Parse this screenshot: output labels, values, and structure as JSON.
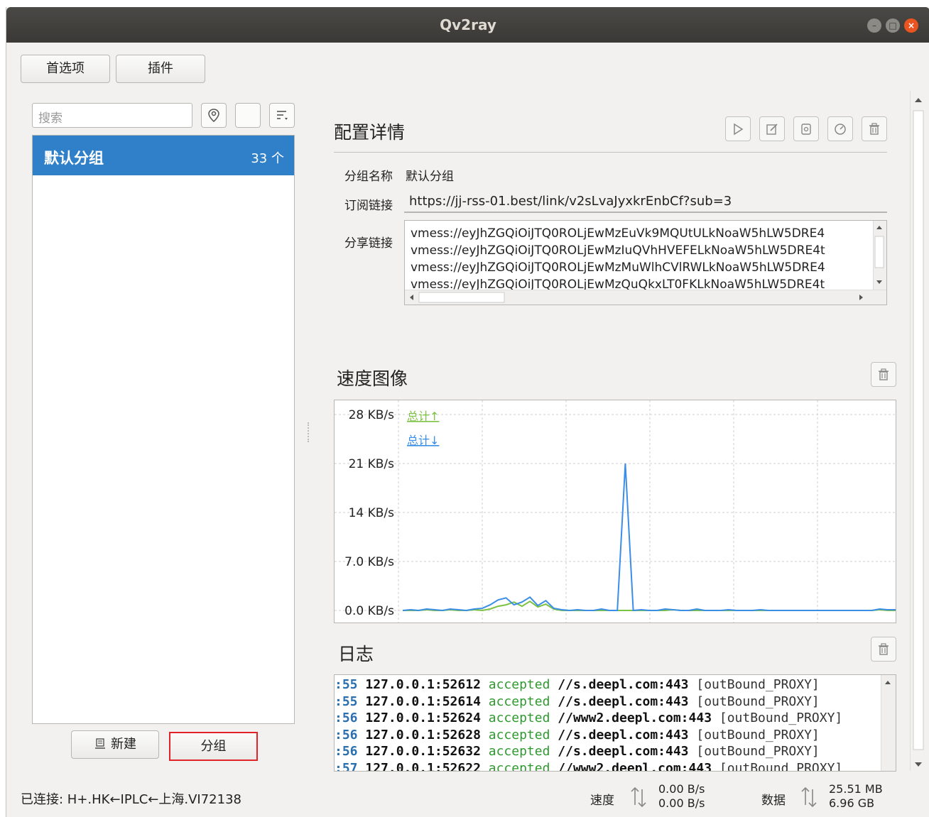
{
  "window": {
    "title": "Qv2ray"
  },
  "toolbar": {
    "preferences": "首选项",
    "plugins": "插件"
  },
  "search": {
    "placeholder": "搜索"
  },
  "group_list": [
    {
      "name": "默认分组",
      "count": "33 个"
    }
  ],
  "left_buttons": {
    "new": "新建",
    "group": "分组"
  },
  "details": {
    "title": "配置详情",
    "group_name_label": "分组名称",
    "group_name_value": "默认分组",
    "subscription_label": "订阅链接",
    "subscription_value": "https://jj-rss-01.best/link/v2sLvaJyxkrEnbCf?sub=3",
    "share_label": "分享链接",
    "share_lines": [
      "vmess://eyJhZGQiOiJTQ0ROLjEwMzEuVk9MQUtULkNoaW5hLW5DRE4",
      "vmess://eyJhZGQiOiJTQ0ROLjEwMzIuQVhHVEFELkNoaW5hLW5DRE4t",
      "vmess://eyJhZGQiOiJTQ0ROLjEwMzMuWlhCVlRWLkNoaW5hLW5DRE4",
      "vmess://eyJhZGQiOiJTQ0ROLjEwMzQuQkxLT0FKLkNoaW5hLW5DRE4t"
    ]
  },
  "speed_chart": {
    "title": "速度图像",
    "legend_up": "总计↑",
    "legend_down": "总计↓"
  },
  "chart_data": {
    "type": "line",
    "title": "速度图像",
    "yticks": [
      "28 KB/s",
      "21 KB/s",
      "14 KB/s",
      "7.0 KB/s",
      "0.0 KB/s"
    ],
    "ylim": [
      0,
      28
    ],
    "grid": true,
    "legend_placement": "top-left",
    "series": [
      {
        "name": "总计↑",
        "color": "#7cc243",
        "values": [
          0,
          0,
          0,
          0.1,
          0,
          0,
          0.1,
          0,
          0,
          0.1,
          0,
          0.2,
          0.6,
          0.8,
          1.2,
          0.6,
          1.3,
          0.5,
          0.9,
          0.2,
          0,
          0,
          0,
          0,
          0,
          0,
          0,
          0,
          0,
          0,
          0,
          0,
          0,
          0,
          0.1,
          0,
          0,
          0,
          0,
          0,
          0,
          0,
          0,
          0,
          0,
          0,
          0,
          0,
          0,
          0,
          0,
          0,
          0,
          0,
          0,
          0,
          0,
          0,
          0,
          0,
          0.1,
          0,
          0
        ]
      },
      {
        "name": "总计↓",
        "color": "#3a8ee6",
        "values": [
          0,
          0.1,
          0,
          0.2,
          0.1,
          0,
          0.2,
          0.1,
          0,
          0.2,
          0.3,
          0.8,
          1.5,
          1.8,
          0.8,
          1.2,
          1.9,
          0.7,
          1.4,
          0.3,
          0.1,
          0,
          0.1,
          0,
          0,
          0.2,
          0,
          0,
          21,
          0,
          0.1,
          0,
          0,
          0.2,
          0.1,
          0,
          0,
          0.2,
          0,
          0,
          0,
          0.1,
          0,
          0,
          0,
          0.1,
          0,
          0,
          0,
          0,
          0,
          0,
          0,
          0,
          0,
          0,
          0,
          0,
          0,
          0,
          0.2,
          0.1,
          0.1
        ]
      }
    ]
  },
  "log": {
    "title": "日志",
    "rows": [
      {
        "time": ":55",
        "ip": "127.0.0.1:52612",
        "status": "accepted",
        "host": "//s.deepl.com:443",
        "outbound": "[outBound_PROXY]"
      },
      {
        "time": ":55",
        "ip": "127.0.0.1:52614",
        "status": "accepted",
        "host": "//s.deepl.com:443",
        "outbound": "[outBound_PROXY]"
      },
      {
        "time": ":56",
        "ip": "127.0.0.1:52624",
        "status": "accepted",
        "host": "//www2.deepl.com:443",
        "outbound": "[outBound_PROXY]"
      },
      {
        "time": ":56",
        "ip": "127.0.0.1:52628",
        "status": "accepted",
        "host": "//s.deepl.com:443",
        "outbound": "[outBound_PROXY]"
      },
      {
        "time": ":56",
        "ip": "127.0.0.1:52632",
        "status": "accepted",
        "host": "//s.deepl.com:443",
        "outbound": "[outBound_PROXY]"
      },
      {
        "time": ":57",
        "ip": "127.0.0.1:52622",
        "status": "accepted",
        "host": "//www2.deepl.com:443",
        "outbound": "[outBound_PROXY]"
      }
    ]
  },
  "statusbar": {
    "connected": "已连接: H+.HK←IPLC←上海.VI72138",
    "speed_label": "速度",
    "speed_up": "0.00 B/s",
    "speed_down": "0.00 B/s",
    "data_label": "数据",
    "data_up": "25.51 MB",
    "data_down": "6.96 GB"
  }
}
